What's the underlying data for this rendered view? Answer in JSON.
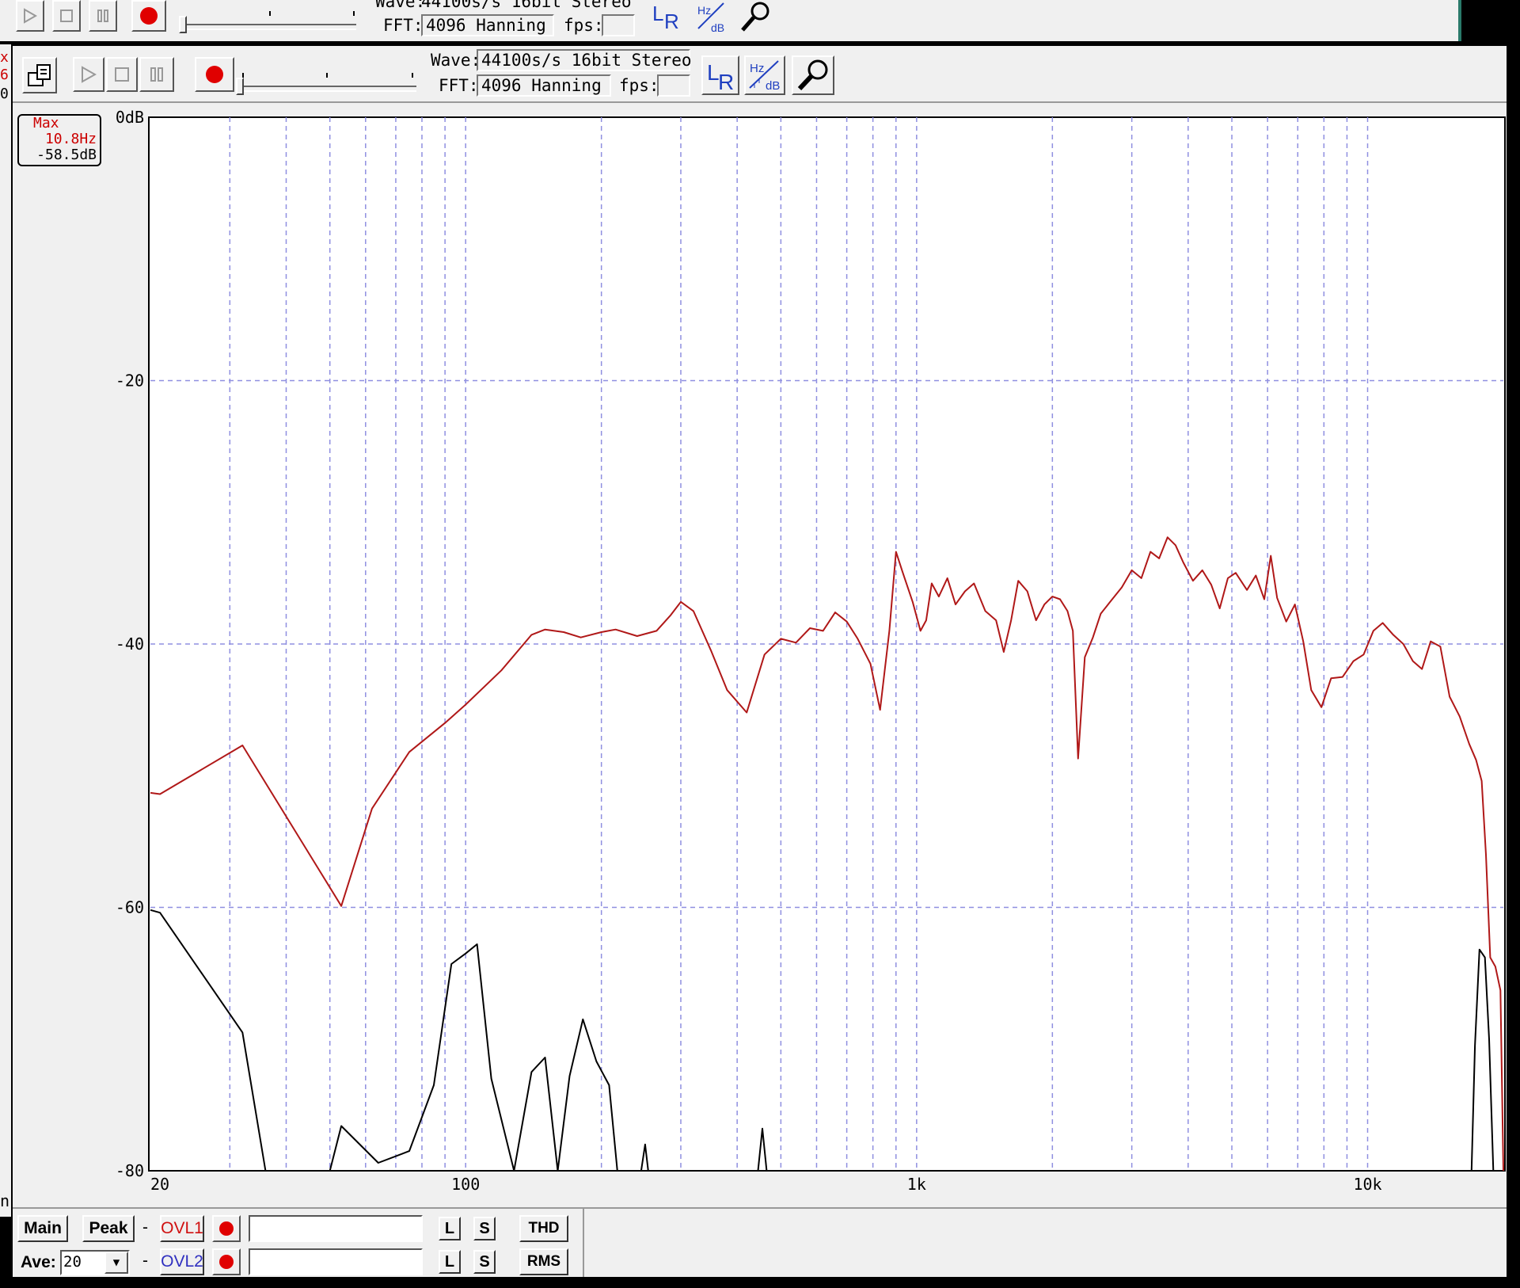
{
  "back_window": {
    "wave_label": "Wave:",
    "wave_value": "44100s/s 16bit Stereo",
    "fft_label": "FFT:",
    "fft_value": "4096 Hanning",
    "fps_label": "fps:",
    "fps_value": ""
  },
  "toolbar": {
    "wave_label": "Wave:",
    "wave_value": "44100s/s 16bit Stereo",
    "fft_label": "FFT:",
    "fft_value": "4096 Hanning",
    "fps_label": "fps:",
    "fps_value": "",
    "lr_label": "LR",
    "hz_label": "Hz",
    "db_label": "dB"
  },
  "left_edge": {
    "chars": [
      "x",
      "6",
      "0."
    ],
    "bottom_char": "n"
  },
  "max_box": {
    "title": "Max",
    "freq": "10.8Hz",
    "level": "-58.5dB"
  },
  "chart_data": {
    "type": "line",
    "x_scale": "log",
    "xlim": [
      20,
      20000
    ],
    "ylim": [
      -80,
      0
    ],
    "grid": true,
    "y_tick_labels": [
      {
        "value": 0,
        "label": "0dB"
      },
      {
        "value": -20,
        "label": "-20"
      },
      {
        "value": -40,
        "label": "-40"
      },
      {
        "value": -60,
        "label": "-60"
      },
      {
        "value": -80,
        "label": "-80"
      }
    ],
    "x_tick_labels": [
      {
        "value": 20,
        "label": "20"
      },
      {
        "value": 100,
        "label": "100"
      },
      {
        "value": 1000,
        "label": "1k"
      },
      {
        "value": 10000,
        "label": "10k"
      }
    ],
    "series": [
      {
        "color": "#b01818",
        "points": [
          [
            20,
            -51.3
          ],
          [
            21,
            -51.4
          ],
          [
            32,
            -47.7
          ],
          [
            53,
            -59.9
          ],
          [
            62,
            -52.5
          ],
          [
            75,
            -48.2
          ],
          [
            90,
            -46
          ],
          [
            100,
            -44.6
          ],
          [
            120,
            -42
          ],
          [
            140,
            -39.3
          ],
          [
            150,
            -38.9
          ],
          [
            165,
            -39.1
          ],
          [
            180,
            -39.5
          ],
          [
            200,
            -39.1
          ],
          [
            215,
            -38.9
          ],
          [
            240,
            -39.4
          ],
          [
            265,
            -39
          ],
          [
            285,
            -37.8
          ],
          [
            300,
            -36.8
          ],
          [
            320,
            -37.5
          ],
          [
            350,
            -40.5
          ],
          [
            380,
            -43.5
          ],
          [
            420,
            -45.2
          ],
          [
            460,
            -40.8
          ],
          [
            500,
            -39.6
          ],
          [
            540,
            -39.9
          ],
          [
            580,
            -38.8
          ],
          [
            620,
            -39
          ],
          [
            660,
            -37.6
          ],
          [
            700,
            -38.3
          ],
          [
            740,
            -39.6
          ],
          [
            790,
            -41.5
          ],
          [
            830,
            -45
          ],
          [
            870,
            -39
          ],
          [
            900,
            -33
          ],
          [
            930,
            -34.5
          ],
          [
            980,
            -36.8
          ],
          [
            1020,
            -39
          ],
          [
            1050,
            -38.2
          ],
          [
            1080,
            -35.4
          ],
          [
            1120,
            -36.4
          ],
          [
            1170,
            -35
          ],
          [
            1220,
            -37
          ],
          [
            1280,
            -36
          ],
          [
            1340,
            -35.4
          ],
          [
            1420,
            -37.5
          ],
          [
            1500,
            -38.2
          ],
          [
            1560,
            -40.6
          ],
          [
            1620,
            -38.2
          ],
          [
            1680,
            -35.2
          ],
          [
            1760,
            -36
          ],
          [
            1840,
            -38.2
          ],
          [
            1920,
            -37
          ],
          [
            2000,
            -36.4
          ],
          [
            2080,
            -36.6
          ],
          [
            2160,
            -37.5
          ],
          [
            2220,
            -39
          ],
          [
            2280,
            -48.7
          ],
          [
            2360,
            -41
          ],
          [
            2460,
            -39.5
          ],
          [
            2560,
            -37.7
          ],
          [
            2700,
            -36.7
          ],
          [
            2850,
            -35.7
          ],
          [
            3000,
            -34.4
          ],
          [
            3150,
            -35
          ],
          [
            3300,
            -33
          ],
          [
            3450,
            -33.5
          ],
          [
            3600,
            -31.9
          ],
          [
            3750,
            -32.5
          ],
          [
            3900,
            -33.8
          ],
          [
            4100,
            -35.2
          ],
          [
            4300,
            -34.4
          ],
          [
            4500,
            -35.5
          ],
          [
            4700,
            -37.3
          ],
          [
            4900,
            -35
          ],
          [
            5100,
            -34.6
          ],
          [
            5400,
            -35.9
          ],
          [
            5650,
            -34.8
          ],
          [
            5900,
            -36.6
          ],
          [
            6100,
            -33.3
          ],
          [
            6300,
            -36.5
          ],
          [
            6600,
            -38.3
          ],
          [
            6900,
            -37
          ],
          [
            7200,
            -39.8
          ],
          [
            7500,
            -43.5
          ],
          [
            7900,
            -44.8
          ],
          [
            8300,
            -42.6
          ],
          [
            8800,
            -42.5
          ],
          [
            9300,
            -41.3
          ],
          [
            9800,
            -40.8
          ],
          [
            10300,
            -39
          ],
          [
            10800,
            -38.4
          ],
          [
            11400,
            -39.3
          ],
          [
            12000,
            -40
          ],
          [
            12600,
            -41.3
          ],
          [
            13200,
            -41.9
          ],
          [
            13800,
            -39.8
          ],
          [
            14500,
            -40.2
          ],
          [
            15200,
            -44
          ],
          [
            16000,
            -45.5
          ],
          [
            16800,
            -47.6
          ],
          [
            17400,
            -48.8
          ],
          [
            17900,
            -50.4
          ],
          [
            18300,
            -56
          ],
          [
            18700,
            -63.8
          ],
          [
            19200,
            -64.5
          ],
          [
            19700,
            -66.3
          ],
          [
            20000,
            -80
          ]
        ]
      },
      {
        "color": "#000000",
        "points": [
          [
            20,
            -60.2
          ],
          [
            21,
            -60.4
          ],
          [
            32,
            -69.5
          ],
          [
            36,
            -80
          ],
          [
            50,
            -80
          ],
          [
            53,
            -76.6
          ],
          [
            64,
            -79.4
          ],
          [
            75,
            -78.5
          ],
          [
            85,
            -73.5
          ],
          [
            93,
            -64.3
          ],
          [
            100,
            -63.5
          ],
          [
            106,
            -62.8
          ],
          [
            114,
            -73
          ],
          [
            128,
            -80
          ],
          [
            140,
            -72.5
          ],
          [
            150,
            -71.4
          ],
          [
            160,
            -80
          ],
          [
            170,
            -72.8
          ],
          [
            182,
            -68.5
          ],
          [
            195,
            -71.7
          ],
          [
            208,
            -73.5
          ],
          [
            217,
            -80
          ],
          [
            245,
            -80
          ],
          [
            250,
            -78
          ],
          [
            254,
            -80
          ],
          [
            445,
            -80
          ],
          [
            455,
            -76.8
          ],
          [
            465,
            -80
          ],
          [
            17000,
            -80
          ],
          [
            17300,
            -70.5
          ],
          [
            17700,
            -63.2
          ],
          [
            18200,
            -63.8
          ],
          [
            18600,
            -70
          ],
          [
            19000,
            -80
          ]
        ]
      }
    ]
  },
  "bottom_panel": {
    "main_label": "Main",
    "peak_label": "Peak",
    "dash1": "-",
    "dash2": "-",
    "ovl1_label": "OVL1",
    "ovl2_label": "OVL2",
    "ovl1_field": "",
    "ovl2_field": "",
    "l_label": "L",
    "s_label": "S",
    "thd_label": "THD",
    "rms_label": "RMS",
    "ave_label": "Ave:",
    "ave_value": "20",
    "dropdown_arrow": "▼",
    "ovl1_color": "#d01010",
    "ovl2_color": "#3030c0"
  }
}
